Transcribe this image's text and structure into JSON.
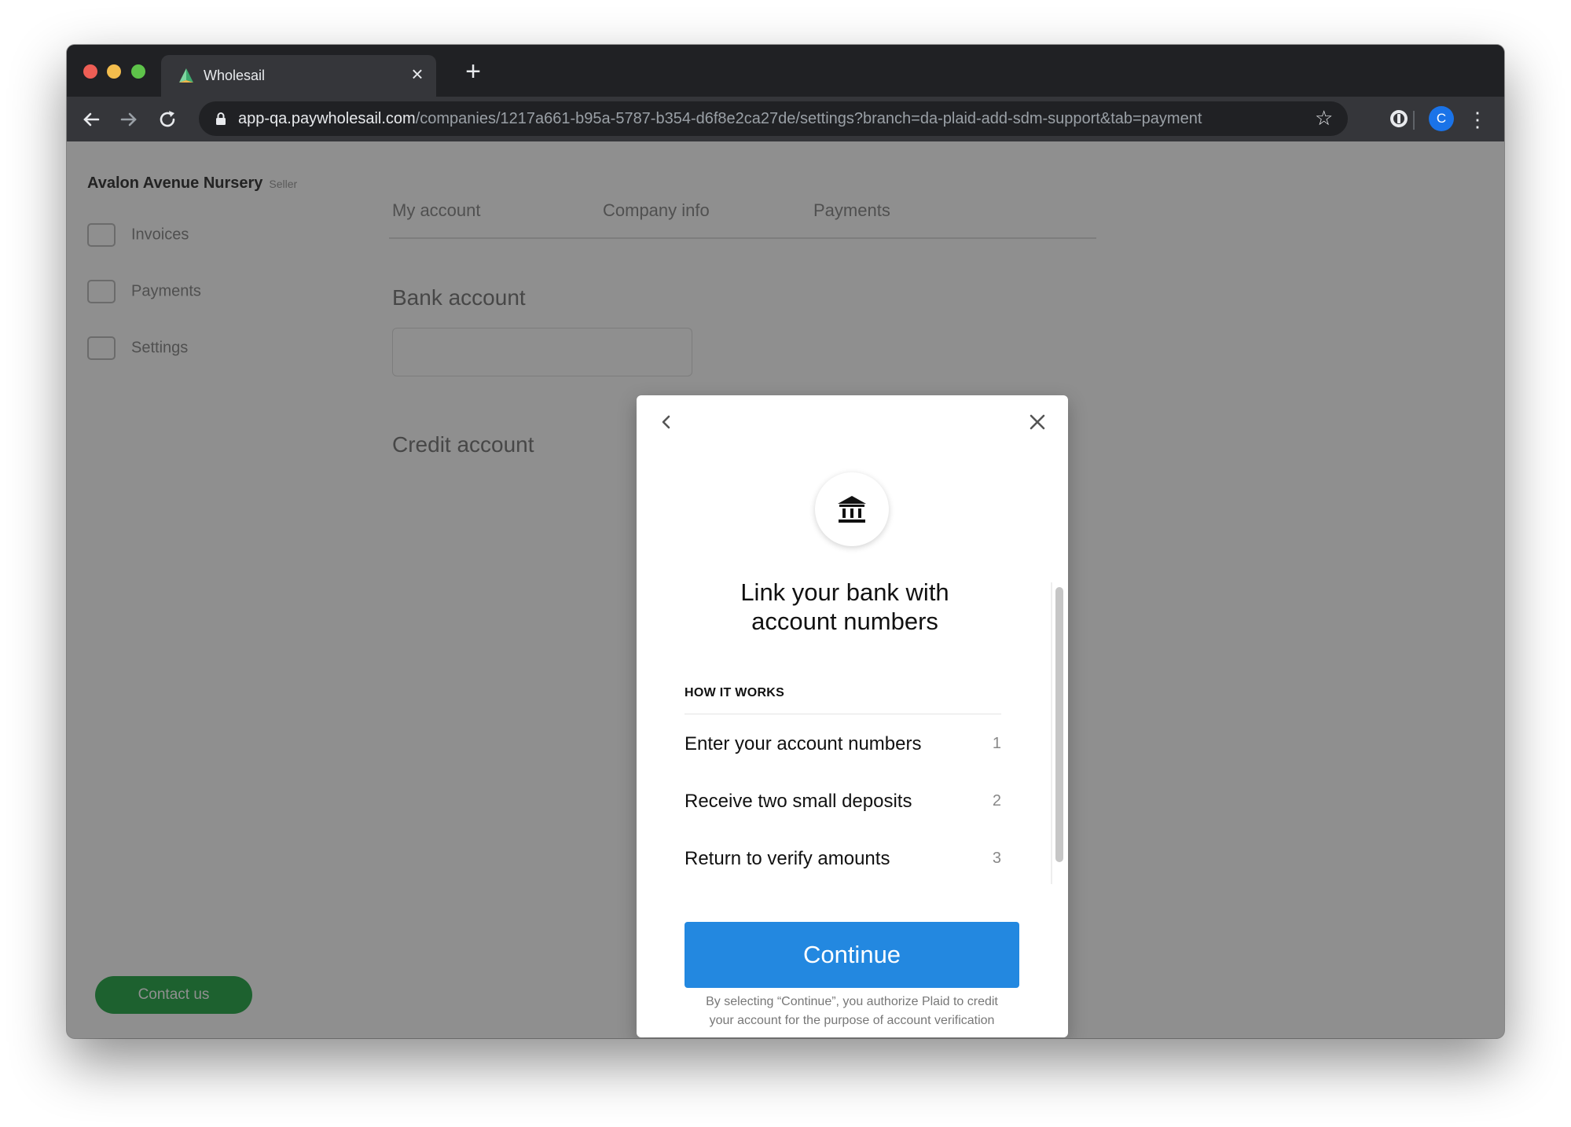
{
  "browser": {
    "tab_title": "Wholesail",
    "new_tab_label": "+",
    "url_host": "app-qa.paywholesail.com",
    "url_path": "/companies/1217a661-b95a-5787-b354-d6f8e2ca27de/settings?branch=da-plaid-add-sdm-support&tab=payment",
    "profile_initial": "C"
  },
  "background_app": {
    "company_name": "Avalon Avenue Nursery",
    "company_suffix": "Seller",
    "nav": [
      "Invoices",
      "Payments",
      "Settings"
    ],
    "settings_tabs": [
      "My account",
      "Company info",
      "Payments"
    ],
    "section_bank": "Bank account",
    "section_credit": "Credit account",
    "contact_button": "Contact us"
  },
  "modal": {
    "title_line1": "Link your bank with",
    "title_line2": "account numbers",
    "how_heading": "HOW IT WORKS",
    "steps": [
      {
        "label": "Enter your account numbers",
        "num": "1"
      },
      {
        "label": "Receive two small deposits",
        "num": "2"
      },
      {
        "label": "Return to verify amounts",
        "num": "3"
      }
    ],
    "continue_label": "Continue",
    "disclaimer_line1": "By selecting “Continue”, you authorize Plaid to credit",
    "disclaimer_line2": "your account for the purpose of account verification"
  },
  "colors": {
    "primary_button": "#2388e0",
    "overlay": "rgba(18,18,18,0.47)",
    "profile": "#1a73e8"
  }
}
